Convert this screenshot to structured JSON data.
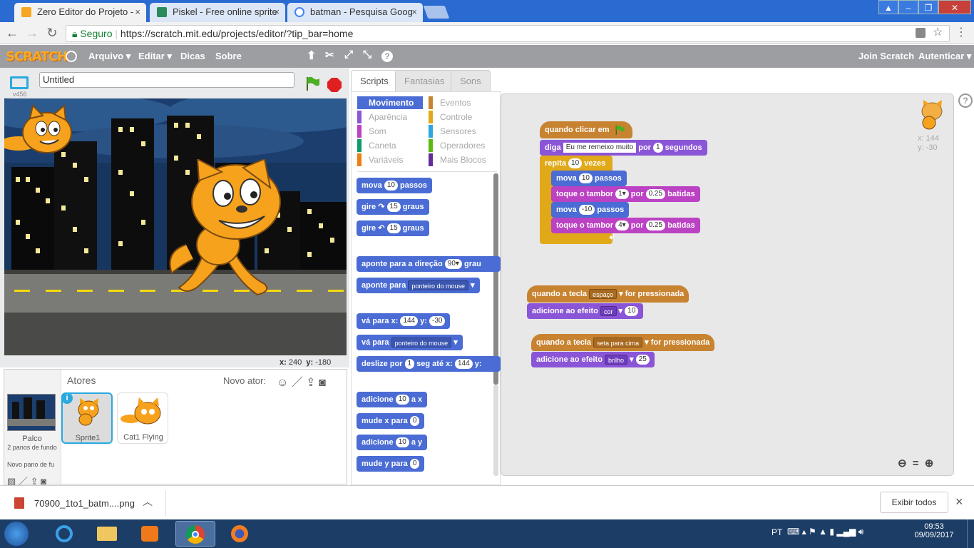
{
  "browser": {
    "tabs": [
      {
        "title": "Zero Editor do Projeto - ",
        "active": true,
        "icon": "scratch-icon"
      },
      {
        "title": "Piskel - Free online sprite",
        "active": false,
        "icon": "piskel-icon"
      },
      {
        "title": "batman - Pesquisa Goog",
        "active": false,
        "icon": "google-icon"
      }
    ],
    "close_glyph": "×",
    "secure_label": "Seguro",
    "url": "https://scratch.mit.edu/projects/editor/?tip_bar=home"
  },
  "menu": {
    "logo": "SCRATCH",
    "items": [
      "Arquivo ▾",
      "Editar ▾",
      "Dicas",
      "Sobre"
    ],
    "join": "Join Scratch",
    "signin": "Autenticar ▾"
  },
  "stage": {
    "version": "v456",
    "project_title": "Untitled",
    "coord_x_label": "x:",
    "coord_x": "240",
    "coord_y_label": "y:",
    "coord_y": "-180"
  },
  "sprites": {
    "header": "Atores",
    "new_sprite": "Novo ator:",
    "stage_label": "Palco",
    "stage_backdrops": "2 panos de fundo",
    "new_backdrop": "Novo pano de fu",
    "items": [
      {
        "name": "Sprite1",
        "selected": true
      },
      {
        "name": "Cat1 Flying",
        "selected": false
      }
    ]
  },
  "editor": {
    "tabs": [
      "Scripts",
      "Fantasias",
      "Sons"
    ],
    "categories": [
      {
        "label": "Movimento",
        "color": "#4a6cd4",
        "selected": true
      },
      {
        "label": "Eventos",
        "color": "#c88330"
      },
      {
        "label": "Aparência",
        "color": "#8a55d7"
      },
      {
        "label": "Controle",
        "color": "#e1a91a"
      },
      {
        "label": "Som",
        "color": "#bb42c3"
      },
      {
        "label": "Sensores",
        "color": "#2ca5e2"
      },
      {
        "label": "Caneta",
        "color": "#0e9a6c"
      },
      {
        "label": "Operadores",
        "color": "#5cb712"
      },
      {
        "label": "Variáveis",
        "color": "#ee7d16"
      },
      {
        "label": "Mais Blocos",
        "color": "#632d99"
      }
    ],
    "palette_blocks": {
      "mova": [
        "mova",
        "10",
        "passos"
      ],
      "gire_r": [
        "gire",
        "15",
        "graus"
      ],
      "gire_l": [
        "gire",
        "15",
        "graus"
      ],
      "aponte_dir": [
        "aponte para a direção",
        "90▾",
        "grau"
      ],
      "aponte_para": [
        "aponte para",
        "ponteiro do mouse"
      ],
      "va_xy": [
        "vá para x:",
        "144",
        "y:",
        "-30"
      ],
      "va_para": [
        "vá para",
        "ponteiro do mouse"
      ],
      "deslize": [
        "deslize por",
        "1",
        "seg até x:",
        "144",
        "y:"
      ],
      "adicione_x": [
        "adicione",
        "10",
        "a x"
      ],
      "mude_x": [
        "mude x para",
        "0"
      ],
      "adicione_y": [
        "adicione",
        "10",
        "a y"
      ],
      "mude_y": [
        "mude y para",
        "0"
      ]
    },
    "sprite_info": {
      "x": "x: 144",
      "y": "y: -30"
    },
    "scripts": {
      "s1": {
        "hat": "quando clicar em",
        "diga": [
          "diga",
          "Eu me remeixo muito",
          "por",
          "1",
          "segundos"
        ],
        "repita": [
          "repita",
          "10",
          "vezes"
        ],
        "b1": [
          "mova",
          "10",
          "passos"
        ],
        "b2": [
          "toque o tambor",
          "1▾",
          "por",
          "0.25",
          "batidas"
        ],
        "b3": [
          "mova",
          "-10",
          "passos"
        ],
        "b4": [
          "toque o tambor",
          "4▾",
          "por",
          "0.25",
          "batidas"
        ]
      },
      "s2": {
        "hat": [
          "quando a tecla",
          "espaço",
          "for pressionada"
        ],
        "effect": [
          "adicione ao efeito",
          "cor",
          "10"
        ]
      },
      "s3": {
        "hat": [
          "quando a tecla",
          "seta para cima",
          "for pressionada"
        ],
        "effect": [
          "adicione ao efeito",
          "brilho",
          "25"
        ]
      }
    },
    "zoom_icons": [
      "zoom-out-icon",
      "zoom-reset-icon",
      "zoom-in-icon"
    ]
  },
  "download_bar": {
    "file": "70900_1to1_batm....png",
    "show_all": "Exibir todos",
    "close": "×"
  },
  "taskbar": {
    "lang": "PT",
    "time": "09:53",
    "date": "09/09/2017"
  }
}
